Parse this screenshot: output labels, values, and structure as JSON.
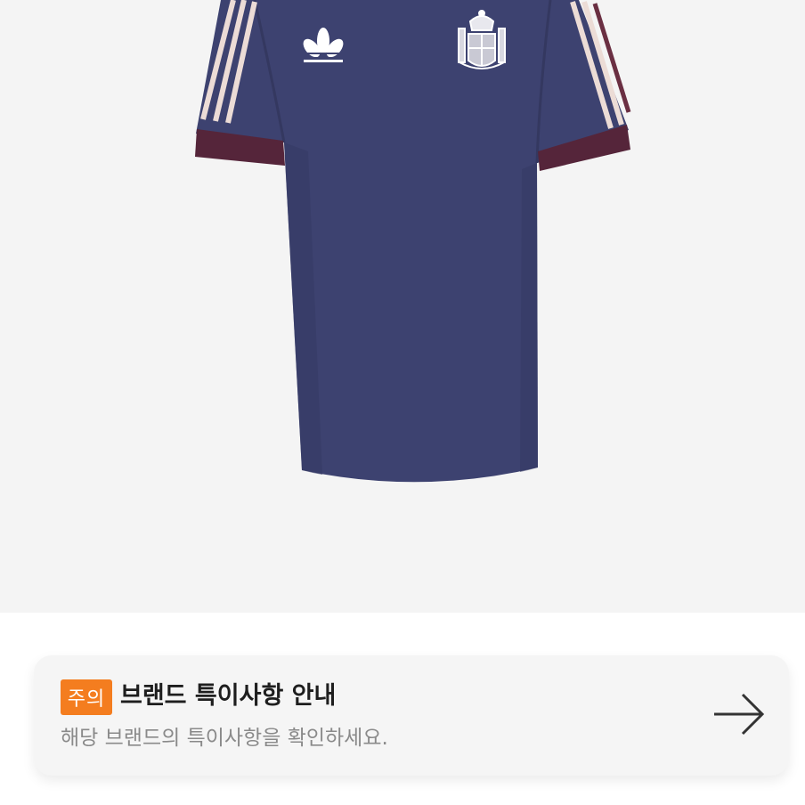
{
  "product": {
    "image": {
      "icon": "jersey-image",
      "colors": {
        "body": "#3d4270",
        "stripes": "#ecdcd6",
        "cuff": "#55253a",
        "background": "#f4f4f4"
      }
    }
  },
  "notice": {
    "badge": "주의",
    "title": "브랜드 특이사항 안내",
    "description": "해당 브랜드의 특이사항을 확인하세요.",
    "arrow_icon": "arrow-right-icon",
    "accent": "#f47d1f"
  }
}
